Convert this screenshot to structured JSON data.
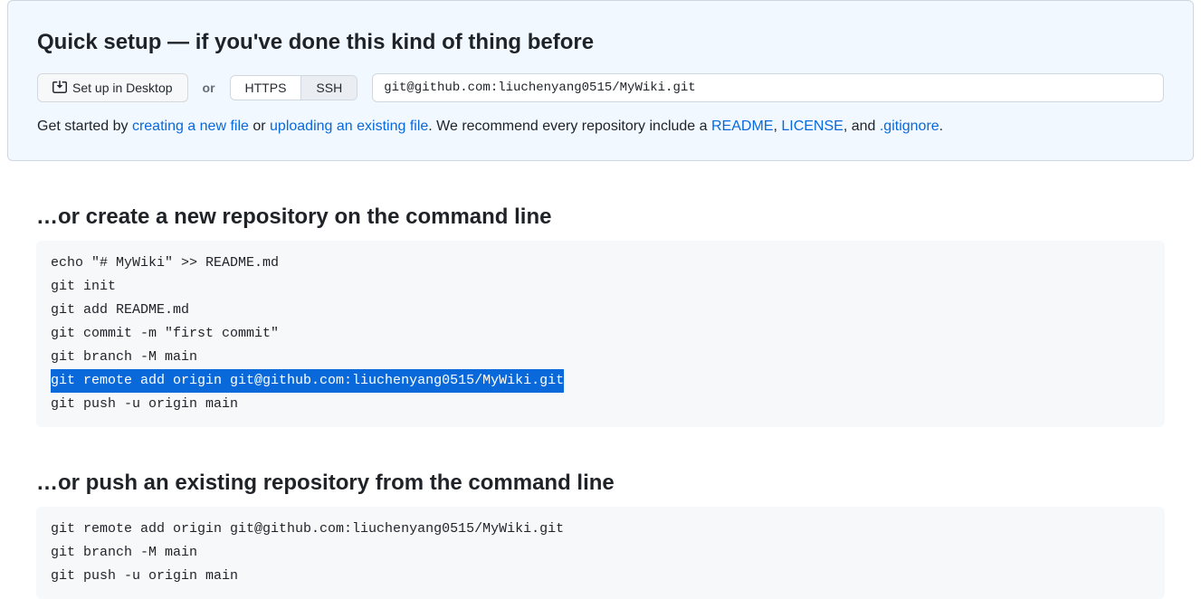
{
  "quickSetup": {
    "title": "Quick setup — if you've done this kind of thing before",
    "desktopButton": "Set up in Desktop",
    "orText": "or",
    "protocol": {
      "https": "HTTPS",
      "ssh": "SSH"
    },
    "repoUrl": "git@github.com:liuchenyang0515/MyWiki.git",
    "helper": {
      "prefix": "Get started by ",
      "createLink": "creating a new file",
      "or": " or ",
      "uploadLink": "uploading an existing file",
      "middle": ". We recommend every repository include a ",
      "readmeLink": "README",
      "comma": ", ",
      "licenseLink": "LICENSE",
      "and": ", and ",
      "gitignoreLink": ".gitignore",
      "period": "."
    }
  },
  "createSection": {
    "title": "…or create a new repository on the command line",
    "lines": [
      "echo \"# MyWiki\" >> README.md",
      "git init",
      "git add README.md",
      "git commit -m \"first commit\"",
      "git branch -M main",
      "git remote add origin git@github.com:liuchenyang0515/MyWiki.git",
      "git push -u origin main"
    ]
  },
  "pushSection": {
    "title": "…or push an existing repository from the command line",
    "lines": [
      "git remote add origin git@github.com:liuchenyang0515/MyWiki.git",
      "git branch -M main",
      "git push -u origin main"
    ]
  }
}
